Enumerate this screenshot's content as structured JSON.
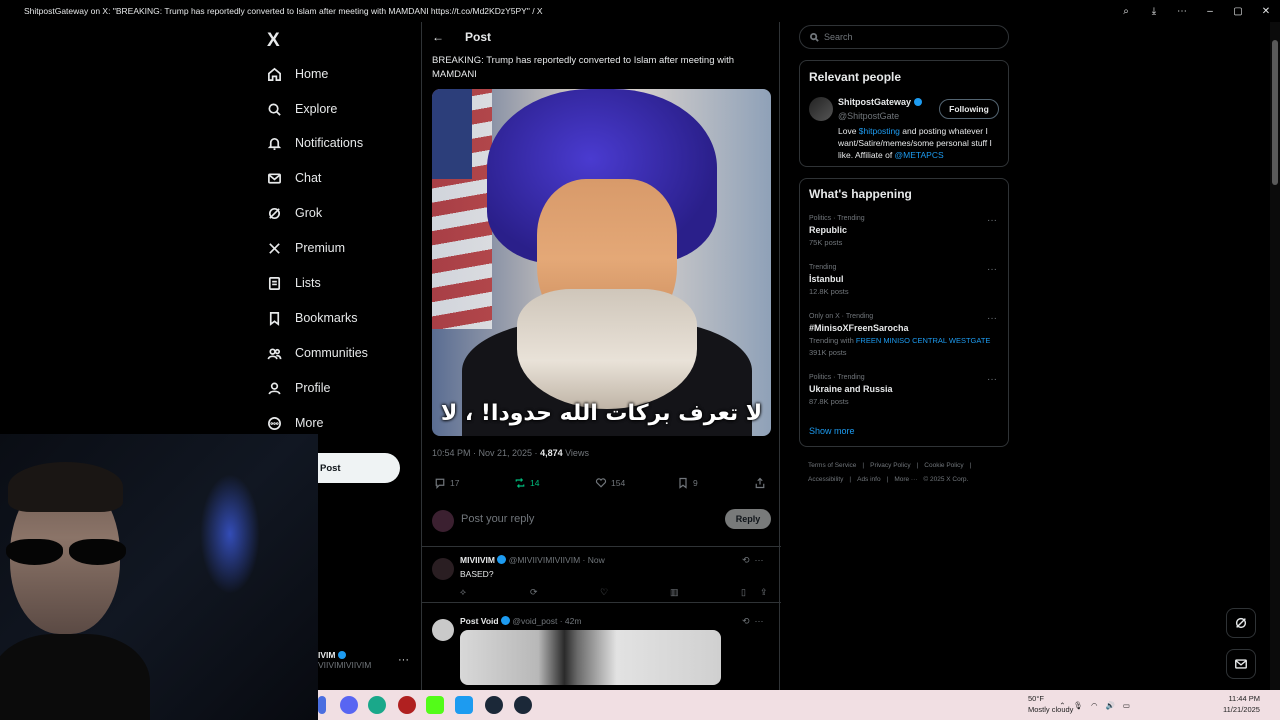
{
  "window": {
    "title": "ShitpostGateway on X: \"BREAKING: Trump has reportedly converted to Islam after meeting with MAMDANI https://t.co/Md2KDzY5PY\" / X"
  },
  "nav": {
    "logo": "X",
    "items": [
      {
        "label": "Home",
        "icon": "home-icon"
      },
      {
        "label": "Explore",
        "icon": "search-icon"
      },
      {
        "label": "Notifications",
        "icon": "bell-icon"
      },
      {
        "label": "Chat",
        "icon": "mail-icon"
      },
      {
        "label": "Grok",
        "icon": "grok-icon"
      },
      {
        "label": "Premium",
        "icon": "x-icon"
      },
      {
        "label": "Lists",
        "icon": "list-icon"
      },
      {
        "label": "Bookmarks",
        "icon": "bookmark-icon"
      },
      {
        "label": "Communities",
        "icon": "people-icon"
      },
      {
        "label": "Profile",
        "icon": "person-icon"
      },
      {
        "label": "More",
        "icon": "more-icon"
      }
    ],
    "post_button": "Post",
    "account_name": "IVIM",
    "account_handle": "VIIVIMIVIIVIM"
  },
  "post": {
    "header": "Post",
    "text": "BREAKING: Trump has reportedly converted to Islam after meeting with MAMDANI",
    "image_overlay_text": "لا تعرف بركات الله حدودا! ، لا",
    "timestamp": "10:54 PM · Nov 21, 2025 · ",
    "views_count": "4,874",
    "views_label": " Views",
    "replies": "17",
    "reposts": "14",
    "likes": "154",
    "bookmarks": "9",
    "reply_placeholder": "Post your reply",
    "reply_button": "Reply"
  },
  "replies": [
    {
      "name": "MIVIIVIM",
      "handle": "@MIVIIVIMIVIIVIM · Now",
      "text": "BASED?"
    },
    {
      "name": "Post Void",
      "handle": "@void_post · 42m",
      "text": ""
    }
  ],
  "search": {
    "placeholder": "Search"
  },
  "relevant": {
    "title": "Relevant people",
    "name": "ShitpostGateway",
    "handle": "@ShitpostGate",
    "follow_label": "Following",
    "bio_prefix": "Love ",
    "bio_link1": "$hitposting",
    "bio_middle": " and posting whatever I want/Satire/memes/some personal stuff I like. Affiliate of ",
    "bio_link2": "@METAPCS"
  },
  "happening": {
    "title": "What's happening",
    "trends": [
      {
        "context": "Politics · Trending",
        "topic": "Republic",
        "count": "75K posts"
      },
      {
        "context": "Trending",
        "topic": "İstanbul",
        "count": "12.8K posts"
      },
      {
        "context": "Only on X · Trending",
        "topic": "#MinisoXFreenSarocha",
        "count": "391K posts",
        "with_prefix": "Trending with ",
        "with_link": "FREEN MINISO CENTRAL WESTGATE"
      },
      {
        "context": "Politics · Trending",
        "topic": "Ukraine and Russia",
        "count": "87.8K posts"
      }
    ],
    "show_more": "Show more"
  },
  "footer": {
    "links": [
      "Terms of Service",
      "|",
      "Privacy Policy",
      "|",
      "Cookie Policy",
      "|",
      "Accessibility",
      "|",
      "Ads info",
      "|",
      "More ···",
      "© 2025 X Corp."
    ]
  },
  "taskbar": {
    "weather_temp": "50°F",
    "weather_desc": "Mostly cloudy",
    "time": "11:44 PM",
    "date": "11/21/2025"
  },
  "colors": {
    "accent": "#1d9bf0",
    "repost": "#00ba7c",
    "background": "#000000",
    "border": "#2f3336"
  }
}
